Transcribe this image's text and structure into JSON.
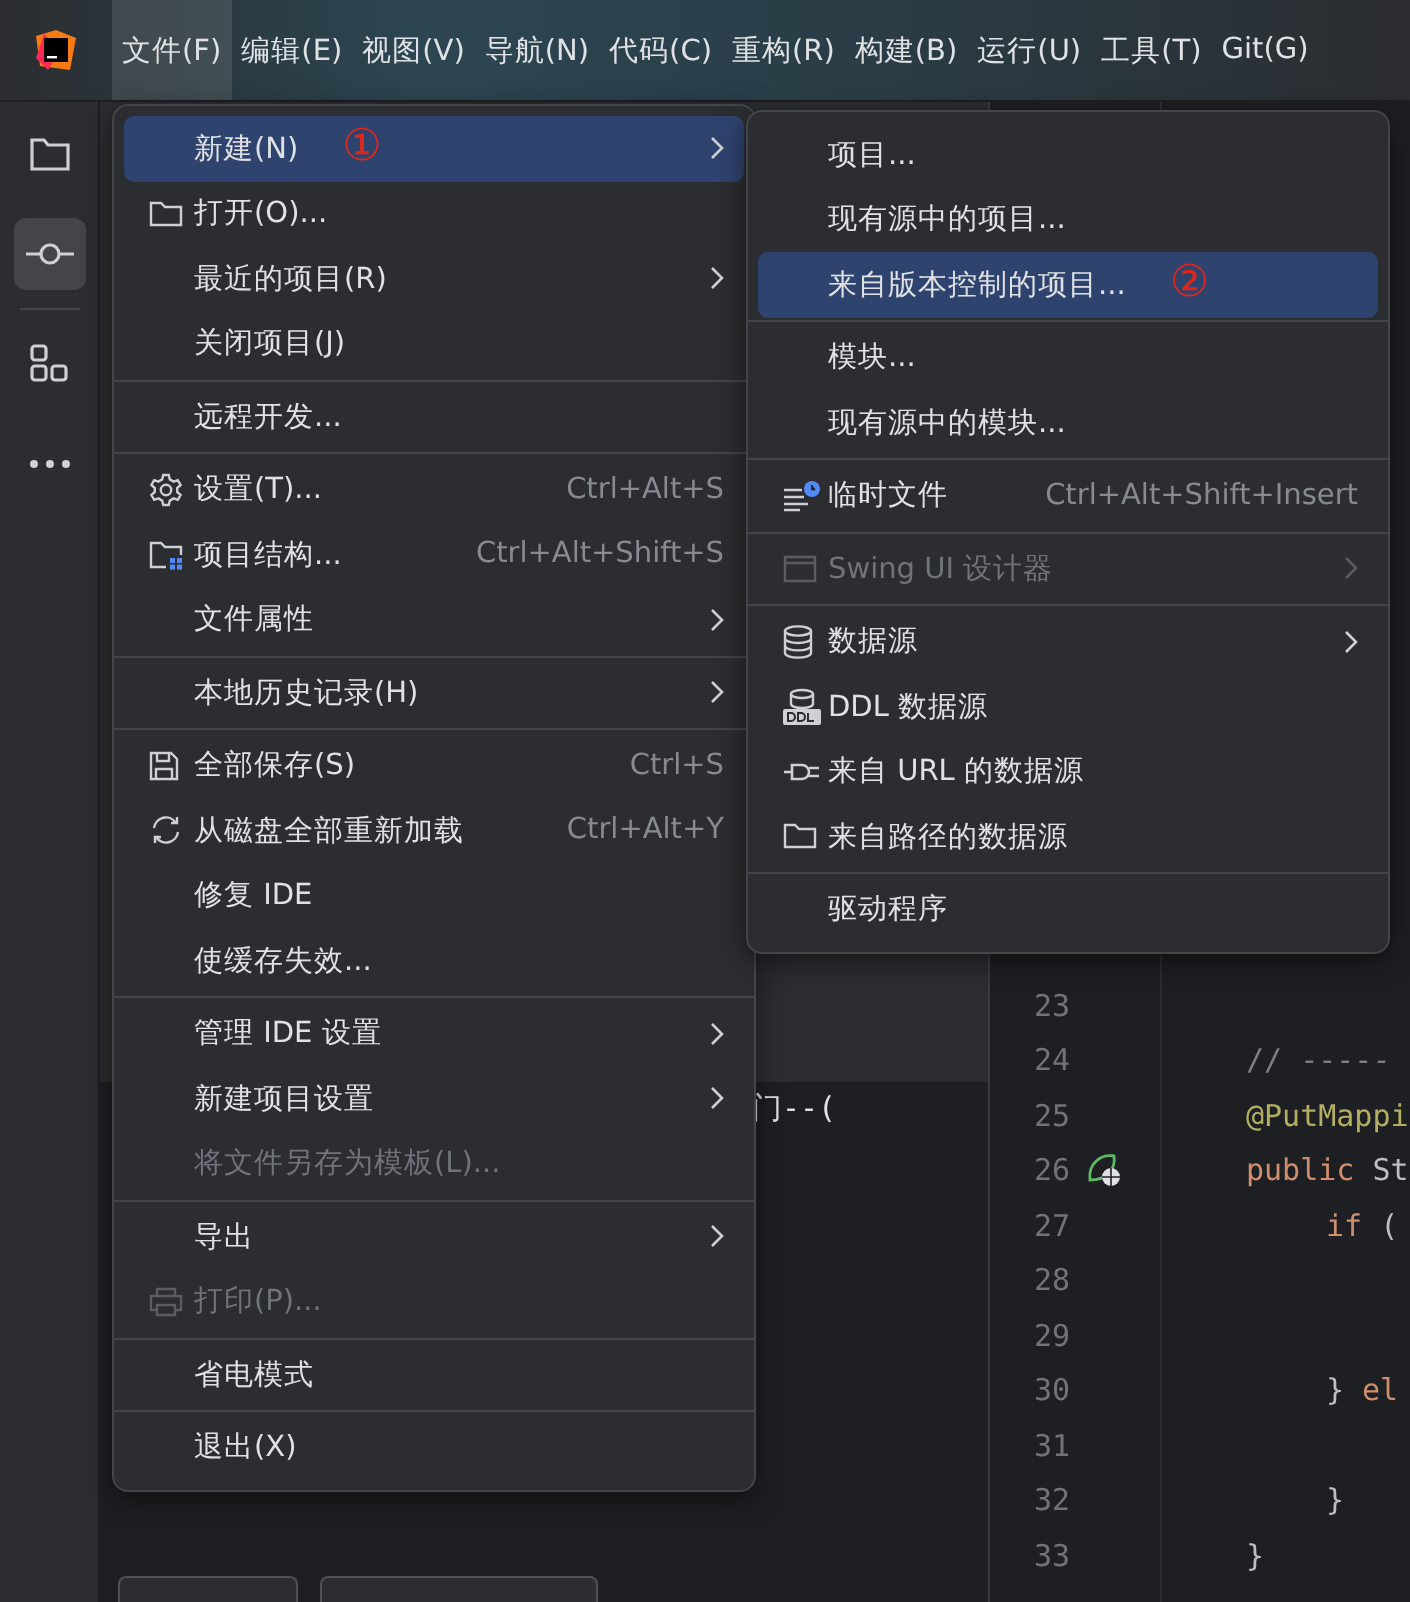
{
  "menu_bar": [
    {
      "label": "文件(F)",
      "selected": true
    },
    {
      "label": "编辑(E)",
      "selected": false
    },
    {
      "label": "视图(V)",
      "selected": false
    },
    {
      "label": "导航(N)",
      "selected": false
    },
    {
      "label": "代码(C)",
      "selected": false
    },
    {
      "label": "重构(R)",
      "selected": false
    },
    {
      "label": "构建(B)",
      "selected": false
    },
    {
      "label": "运行(U)",
      "selected": false
    },
    {
      "label": "工具(T)",
      "selected": false
    },
    {
      "label": "Git(G)",
      "selected": false
    }
  ],
  "tool_strip": [
    {
      "selected": false
    },
    {
      "selected": true
    },
    {
      "selected": false
    },
    {
      "selected": false
    }
  ],
  "panel": {
    "tree_text": "门--(",
    "buttons": [
      {
        "kind": "outline"
      },
      {
        "kind": "outline"
      }
    ]
  },
  "editor": {
    "lines": [
      {
        "number": "23",
        "marker": false
      },
      {
        "number": "24",
        "indented": false,
        "marker": false,
        "code": [
          {
            "kind": "comment",
            "text": "// -----"
          }
        ]
      },
      {
        "number": "25",
        "indented": false,
        "marker": false,
        "code": [
          {
            "kind": "annotation",
            "text": "@PutMappi"
          }
        ]
      },
      {
        "number": "26",
        "indented": false,
        "marker": true,
        "code": [
          {
            "kind": "keyword",
            "text": "public"
          },
          {
            "kind": "plain",
            "text": "St"
          }
        ]
      },
      {
        "number": "27",
        "indented": true,
        "marker": false,
        "code": [
          {
            "kind": "keyword",
            "text": "if"
          },
          {
            "kind": "plain",
            "text": "("
          }
        ]
      },
      {
        "number": "28",
        "marker": false
      },
      {
        "number": "29",
        "marker": false
      },
      {
        "number": "30",
        "indented": true,
        "marker": false,
        "code": [
          {
            "kind": "plain",
            "text": "}"
          },
          {
            "kind": "keyword",
            "text": "el"
          }
        ]
      },
      {
        "number": "31",
        "marker": false
      },
      {
        "number": "32",
        "indented": true,
        "marker": false,
        "code": [
          {
            "kind": "plain",
            "text": "}"
          }
        ]
      },
      {
        "number": "33",
        "indented": false,
        "marker": false,
        "code": [
          {
            "kind": "plain",
            "text": "}"
          }
        ]
      }
    ]
  },
  "main_menu": {
    "items": [
      {
        "kind": "item",
        "label": "新建(N)",
        "annotation": "①",
        "submenu": true,
        "selected": true,
        "disabled": false
      },
      {
        "kind": "item",
        "label": "打开(O)...",
        "submenu": false,
        "selected": false,
        "disabled": false
      },
      {
        "kind": "item",
        "label": "最近的项目(R)",
        "submenu": true,
        "selected": false,
        "disabled": false
      },
      {
        "kind": "item",
        "label": "关闭项目(J)",
        "submenu": false,
        "selected": false,
        "disabled": false
      },
      {
        "kind": "separator"
      },
      {
        "kind": "item",
        "label": "远程开发...",
        "submenu": false,
        "selected": false,
        "disabled": false
      },
      {
        "kind": "separator"
      },
      {
        "kind": "item",
        "label": "设置(T)...",
        "shortcut": "Ctrl+Alt+S",
        "submenu": false,
        "selected": false,
        "disabled": false
      },
      {
        "kind": "item",
        "label": "项目结构...",
        "shortcut": "Ctrl+Alt+Shift+S",
        "submenu": false,
        "selected": false,
        "disabled": false
      },
      {
        "kind": "item",
        "label": "文件属性",
        "submenu": true,
        "selected": false,
        "disabled": false
      },
      {
        "kind": "separator"
      },
      {
        "kind": "item",
        "label": "本地历史记录(H)",
        "submenu": true,
        "selected": false,
        "disabled": false
      },
      {
        "kind": "separator"
      },
      {
        "kind": "item",
        "label": "全部保存(S)",
        "shortcut": "Ctrl+S",
        "submenu": false,
        "selected": false,
        "disabled": false
      },
      {
        "kind": "item",
        "label": "从磁盘全部重新加载",
        "shortcut": "Ctrl+Alt+Y",
        "submenu": false,
        "selected": false,
        "disabled": false
      },
      {
        "kind": "item",
        "label": "修复 IDE",
        "submenu": false,
        "selected": false,
        "disabled": false
      },
      {
        "kind": "item",
        "label": "使缓存失效...",
        "submenu": false,
        "selected": false,
        "disabled": false
      },
      {
        "kind": "separator"
      },
      {
        "kind": "item",
        "label": "管理 IDE 设置",
        "submenu": true,
        "selected": false,
        "disabled": false
      },
      {
        "kind": "item",
        "label": "新建项目设置",
        "submenu": true,
        "selected": false,
        "disabled": false
      },
      {
        "kind": "item",
        "label": "将文件另存为模板(L)...",
        "submenu": false,
        "selected": false,
        "disabled": true
      },
      {
        "kind": "separator"
      },
      {
        "kind": "item",
        "label": "导出",
        "submenu": true,
        "selected": false,
        "disabled": false
      },
      {
        "kind": "item",
        "label": "打印(P)...",
        "submenu": false,
        "selected": false,
        "disabled": true
      },
      {
        "kind": "separator"
      },
      {
        "kind": "item",
        "label": "省电模式",
        "submenu": false,
        "selected": false,
        "disabled": false
      },
      {
        "kind": "separator"
      },
      {
        "kind": "item",
        "label": "退出(X)",
        "submenu": false,
        "selected": false,
        "disabled": false
      }
    ]
  },
  "new_submenu": {
    "items": [
      {
        "kind": "item",
        "label": "项目...",
        "submenu": false,
        "selected": false,
        "disabled": false
      },
      {
        "kind": "item",
        "label": "现有源中的项目...",
        "submenu": false,
        "selected": false,
        "disabled": false
      },
      {
        "kind": "item",
        "label": "来自版本控制的项目...",
        "annotation": "②",
        "submenu": false,
        "selected": true,
        "disabled": false
      },
      {
        "kind": "separator"
      },
      {
        "kind": "item",
        "label": "模块...",
        "submenu": false,
        "selected": false,
        "disabled": false
      },
      {
        "kind": "item",
        "label": "现有源中的模块...",
        "submenu": false,
        "selected": false,
        "disabled": false
      },
      {
        "kind": "separator"
      },
      {
        "kind": "item",
        "label": "临时文件",
        "shortcut": "Ctrl+Alt+Shift+Insert",
        "submenu": false,
        "selected": false,
        "disabled": false
      },
      {
        "kind": "separator"
      },
      {
        "kind": "item",
        "label": "Swing UI 设计器",
        "submenu": true,
        "selected": false,
        "disabled": true
      },
      {
        "kind": "separator"
      },
      {
        "kind": "item",
        "label": "数据源",
        "submenu": true,
        "selected": false,
        "disabled": false
      },
      {
        "kind": "item",
        "label": "DDL 数据源",
        "submenu": false,
        "selected": false,
        "disabled": false
      },
      {
        "kind": "item",
        "label": "来自 URL 的数据源",
        "submenu": false,
        "selected": false,
        "disabled": false
      },
      {
        "kind": "item",
        "label": "来自路径的数据源",
        "submenu": false,
        "selected": false,
        "disabled": false
      },
      {
        "kind": "separator"
      },
      {
        "kind": "item",
        "label": "驱动程序",
        "submenu": false,
        "selected": false,
        "disabled": false
      }
    ]
  }
}
